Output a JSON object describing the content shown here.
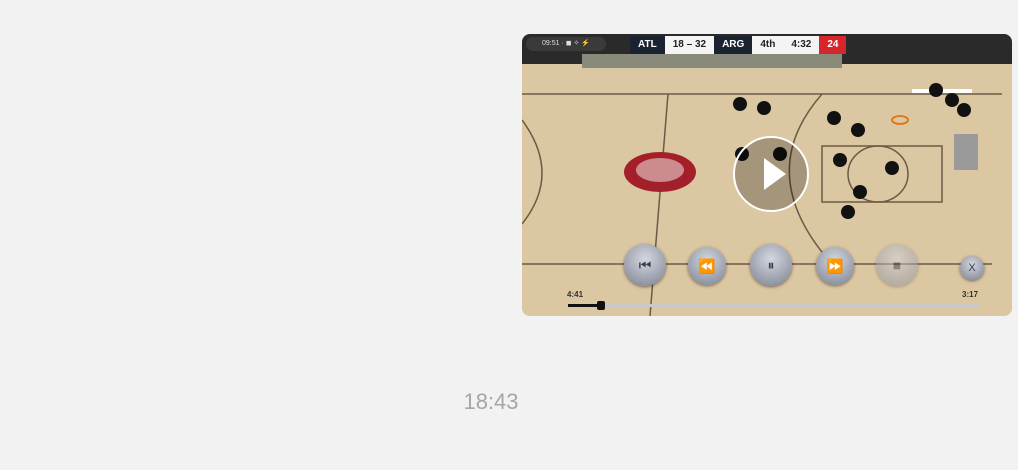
{
  "message": {
    "timestamp": "18:43",
    "video": {
      "status_bar": "09:51 · ◼ ✧ ⚡",
      "scoreboard": {
        "home_team": "ATL",
        "score": "18 – 32",
        "away_team": "ARG",
        "period": "4th",
        "clock": "4:32",
        "shot_clock": "24"
      },
      "elapsed": "4:41",
      "duration": "3:17",
      "progress": 0.08,
      "controls": {
        "prev_icon": "⏮",
        "rewind_icon": "⏪",
        "pause_icon": "⏸",
        "forward_icon": "⏩",
        "stop_icon": "■",
        "close_icon": "X"
      }
    }
  }
}
